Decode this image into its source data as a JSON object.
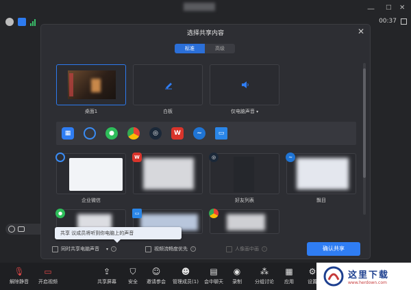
{
  "topbar": {
    "minimize": "—",
    "window_toggle": "标准",
    "maximize": "□",
    "close": "✕",
    "timer": "00:37"
  },
  "modal": {
    "title": "选择共享内容",
    "close": "✕",
    "tabs": [
      {
        "label": "标准",
        "active": true
      },
      {
        "label": "高级",
        "active": false
      }
    ],
    "row1": [
      {
        "label": "桌面1",
        "selected": true
      },
      {
        "label": "白板",
        "selected": false
      },
      {
        "label": "仅电脑声音",
        "selected": false,
        "has_dropdown": true
      }
    ],
    "app_strip_icons": [
      "windows-grid-icon",
      "tencent-meeting-icon",
      "wechat-icon",
      "chrome-icon",
      "steam-icon",
      "wps-icon",
      "edge-like-icon",
      "window-frame-icon"
    ],
    "row2": [
      {
        "label": "企业微信",
        "app_icon": "wecom-icon"
      },
      {
        "label": "",
        "app_icon": "wps-icon"
      },
      {
        "label": "好友列表",
        "app_icon": "steam-icon"
      },
      {
        "label": "飘目",
        "app_icon": "edge-like-icon"
      }
    ],
    "row3": [
      {
        "label": "",
        "app_icon": "wechat-icon"
      },
      {
        "label": "",
        "app_icon": "window-frame-icon"
      },
      {
        "label": "",
        "app_icon": "chrome-icon"
      }
    ],
    "tooltip": "共享 议成员将听到你电脑上的声音",
    "options": {
      "share_audio": "同时共享电脑声音",
      "video_priority": "视频流畅度优先",
      "portrait_mode": "人像画中画"
    },
    "confirm": "确认共享"
  },
  "toolbar": {
    "items": [
      {
        "label": "解除静音",
        "icon": "mic-muted-icon"
      },
      {
        "label": "开启视频",
        "icon": "camera-off-icon"
      },
      {
        "label": "共享屏幕",
        "icon": "share-screen-icon"
      },
      {
        "label": "安全",
        "icon": "shield-icon"
      },
      {
        "label": "邀请参会",
        "icon": "invite-icon"
      },
      {
        "label": "管理成员(1)",
        "icon": "members-icon"
      },
      {
        "label": "会中聊天",
        "icon": "chat-icon"
      },
      {
        "label": "录制",
        "icon": "record-icon"
      },
      {
        "label": "分组讨论",
        "icon": "breakout-icon"
      },
      {
        "label": "应用",
        "icon": "apps-icon"
      },
      {
        "label": "设置",
        "icon": "settings-icon"
      }
    ]
  },
  "watermark": {
    "main": "这里下载",
    "sub": "www.herdown.com"
  },
  "colors": {
    "accent": "#2f7df3",
    "background": "#242528",
    "modal_bg": "#2d2e33"
  }
}
